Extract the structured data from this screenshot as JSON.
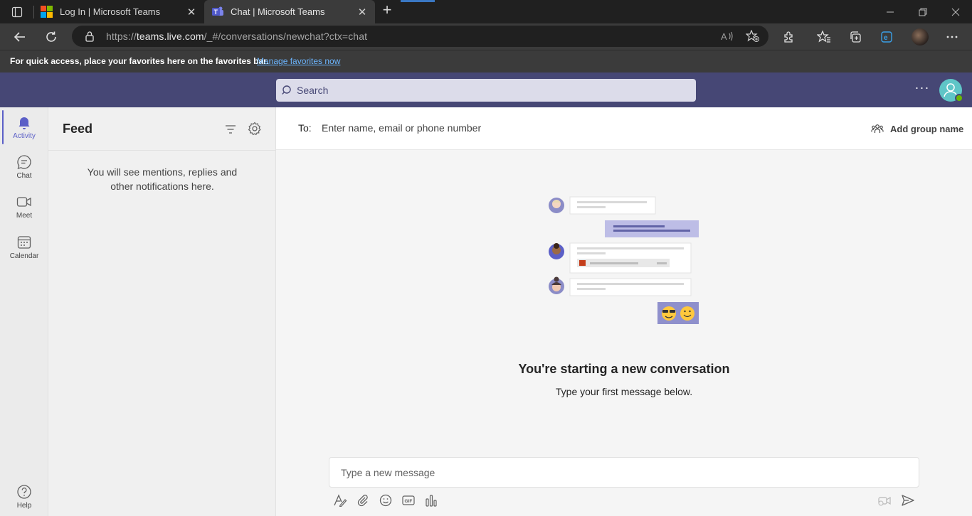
{
  "browser": {
    "tabs": [
      {
        "title": "Log In | Microsoft Teams",
        "icon": "microsoft-logo-icon"
      },
      {
        "title": "Chat | Microsoft Teams",
        "icon": "teams-logo-icon",
        "active": true
      }
    ],
    "url": {
      "prefix": "https://",
      "host": "teams.live.com",
      "path": "/_#/conversations/newchat?ctx=chat"
    },
    "favorites_bar": {
      "message": "For quick access, place your favorites here on the favorites bar.",
      "link": "Manage favorites now"
    }
  },
  "teams": {
    "search_placeholder": "Search",
    "header_more": "···",
    "rail": [
      {
        "label": "Activity",
        "icon": "bell-icon",
        "active": true
      },
      {
        "label": "Chat",
        "icon": "chat-icon"
      },
      {
        "label": "Meet",
        "icon": "video-camera-icon"
      },
      {
        "label": "Calendar",
        "icon": "calendar-icon"
      },
      {
        "label": "Help",
        "icon": "help-icon"
      }
    ],
    "feed": {
      "title": "Feed",
      "empty_message": "You will see mentions, replies and other notifications here."
    },
    "chat": {
      "to_label": "To:",
      "to_placeholder": "Enter name, email or phone number",
      "add_group_name": "Add group name",
      "title": "You're starting a new conversation",
      "subtitle": "Type your first message below.",
      "compose_placeholder": "Type a new message"
    }
  },
  "colors": {
    "teams_purple": "#464775",
    "accent": "#5b5fc7",
    "presence": "#6bb700"
  }
}
